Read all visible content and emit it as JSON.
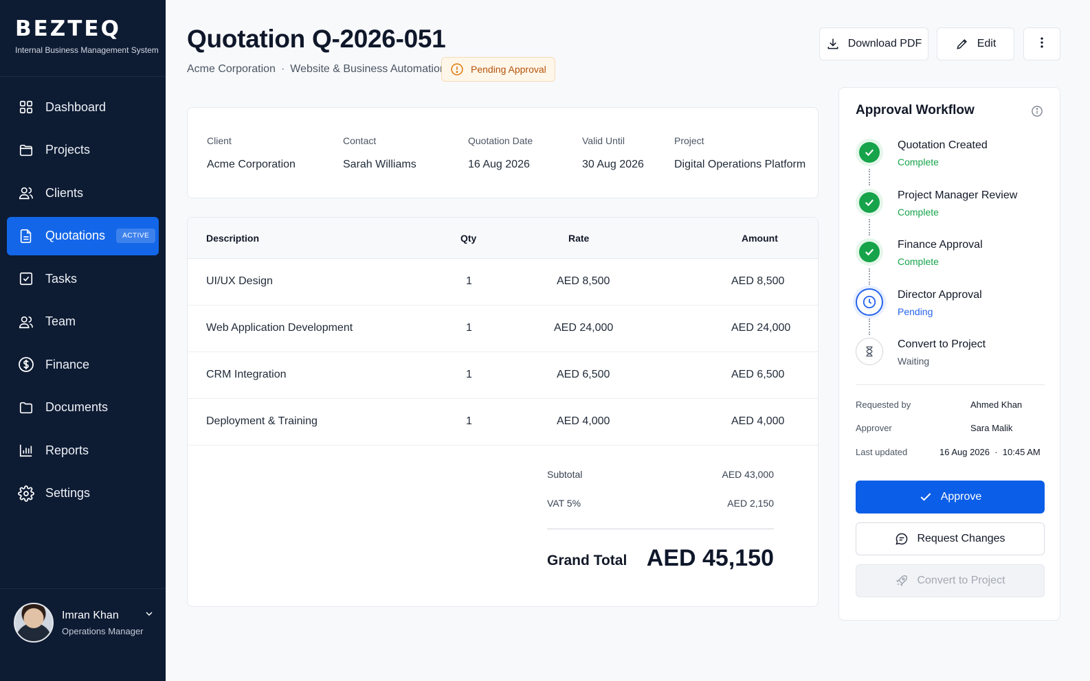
{
  "brand": {
    "name": "BEZTEQ",
    "tagline": "Internal Business Management System"
  },
  "sidebar": {
    "items": [
      {
        "label": "Dashboard",
        "icon": "grid-icon"
      },
      {
        "label": "Projects",
        "icon": "folder-icon"
      },
      {
        "label": "Clients",
        "icon": "users-icon"
      },
      {
        "label": "Quotations",
        "icon": "file-icon",
        "badge": "ACTIVE",
        "active": true
      },
      {
        "label": "Tasks",
        "icon": "checkbox-icon"
      },
      {
        "label": "Team",
        "icon": "team-icon"
      },
      {
        "label": "Finance",
        "icon": "dollar-icon"
      },
      {
        "label": "Documents",
        "icon": "folder-icon"
      },
      {
        "label": "Reports",
        "icon": "bar-chart-icon"
      },
      {
        "label": "Settings",
        "icon": "gear-icon"
      }
    ]
  },
  "user": {
    "name": "Imran Khan",
    "role": "Operations Manager"
  },
  "header": {
    "title": "Quotation Q-2026-051",
    "client": "Acme Corporation",
    "separator": "·",
    "project_type": "Website & Business Automation",
    "status": "Pending Approval",
    "download_label": "Download PDF",
    "edit_label": "Edit"
  },
  "info": {
    "client_label": "Client",
    "client": "Acme Corporation",
    "contact_label": "Contact",
    "contact": "Sarah Williams",
    "date_label": "Quotation Date",
    "date": "16 Aug 2026",
    "valid_label": "Valid Until",
    "valid": "30 Aug 2026",
    "project_label": "Project",
    "project": "Digital Operations Platform"
  },
  "table": {
    "headers": {
      "description": "Description",
      "qty": "Qty",
      "rate": "Rate",
      "amount": "Amount"
    },
    "rows": [
      {
        "description": "UI/UX Design",
        "qty": "1",
        "rate": "AED 8,500",
        "amount": "AED 8,500"
      },
      {
        "description": "Web Application Development",
        "qty": "1",
        "rate": "AED 24,000",
        "amount": "AED 24,000"
      },
      {
        "description": "CRM Integration",
        "qty": "1",
        "rate": "AED 6,500",
        "amount": "AED 6,500"
      },
      {
        "description": "Deployment & Training",
        "qty": "1",
        "rate": "AED 4,000",
        "amount": "AED 4,000"
      }
    ]
  },
  "totals": {
    "subtotal_label": "Subtotal",
    "subtotal": "AED 43,000",
    "vat_label": "VAT 5%",
    "vat": "AED 2,150",
    "grand_label": "Grand Total",
    "grand": "AED 45,150"
  },
  "workflow": {
    "title": "Approval Workflow",
    "steps": [
      {
        "name": "Quotation Created",
        "status": "Complete",
        "state": "done"
      },
      {
        "name": "Project Manager Review",
        "status": "Complete",
        "state": "done"
      },
      {
        "name": "Finance Approval",
        "status": "Complete",
        "state": "done"
      },
      {
        "name": "Director Approval",
        "status": "Pending",
        "state": "pending"
      },
      {
        "name": "Convert to Project",
        "status": "Waiting",
        "state": "waiting"
      }
    ],
    "requested_by_label": "Requested by",
    "requested_by": "Ahmed Khan",
    "approver_label": "Approver",
    "approver": "Sara Malik",
    "updated_label": "Last updated",
    "updated": "16 Aug 2026  ·  10:45 AM",
    "approve_label": "Approve",
    "request_changes_label": "Request Changes",
    "convert_label": "Convert to Project"
  },
  "colors": {
    "primary": "#0b5ee8",
    "sidebar": "#0d1b33",
    "success": "#16a34a",
    "warning": "#b45309",
    "pending": "#2563eb"
  }
}
